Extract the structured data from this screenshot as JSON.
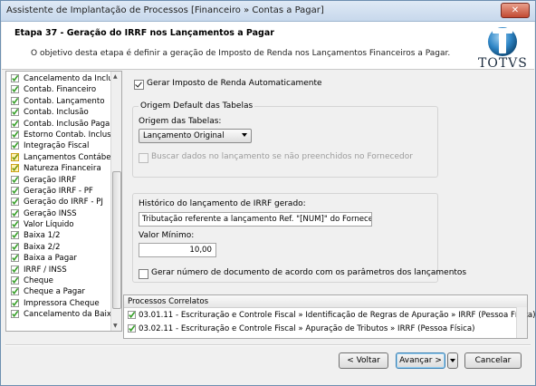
{
  "window": {
    "title": "Assistente de Implantação de Processos [Financeiro » Contas a Pagar]",
    "close_glyph": "✕"
  },
  "header": {
    "title": "Etapa 37 - Geração do IRRF nos Lançamentos a Pagar",
    "description": "O objetivo desta etapa é definir a geração de Imposto de Renda nos Lançamentos Financeiros a Pagar.",
    "logo_text": "TOTVS"
  },
  "steps": [
    {
      "label": "Cancelamento da Inclusão",
      "icon": "check-icon"
    },
    {
      "label": "Contab. Financeiro",
      "icon": "check-icon"
    },
    {
      "label": "Contab. Lançamento",
      "icon": "check-icon"
    },
    {
      "label": "Contab. Inclusão",
      "icon": "check-icon"
    },
    {
      "label": "Contab. Inclusão Pagar",
      "icon": "check-icon"
    },
    {
      "label": "Estorno Contab. Inclusão",
      "icon": "check-icon"
    },
    {
      "label": "Integração Fiscal",
      "icon": "check-icon"
    },
    {
      "label": "Lançamentos Contábeis",
      "icon": "warning-check-icon"
    },
    {
      "label": "Natureza Financeira",
      "icon": "warning-check-icon"
    },
    {
      "label": "Geração IRRF",
      "icon": "check-icon"
    },
    {
      "label": "Geração IRRF - PF",
      "icon": "check-icon"
    },
    {
      "label": "Geração do IRRF - PJ",
      "icon": "check-icon"
    },
    {
      "label": "Geração INSS",
      "icon": "check-icon"
    },
    {
      "label": "Valor Líquido",
      "icon": "check-icon"
    },
    {
      "label": "Baixa 1/2",
      "icon": "check-icon"
    },
    {
      "label": "Baixa 2/2",
      "icon": "check-icon"
    },
    {
      "label": "Baixa a Pagar",
      "icon": "check-icon"
    },
    {
      "label": "IRRF / INSS",
      "icon": "check-icon"
    },
    {
      "label": "Cheque",
      "icon": "check-icon"
    },
    {
      "label": "Cheque a Pagar",
      "icon": "check-icon"
    },
    {
      "label": "Impressora Cheque",
      "icon": "check-icon"
    },
    {
      "label": "Cancelamento da Baixa",
      "icon": "check-icon"
    }
  ],
  "form": {
    "gerar_irrf_label": "Gerar Imposto de Renda Automaticamente",
    "gerar_irrf_checked": true,
    "origem_group_title": "Origem Default das Tabelas",
    "origem_label": "Origem das Tabelas:",
    "origem_value": "Lançamento Original",
    "buscar_label": "Buscar dados no lançamento se não preenchidos no Fornecedor",
    "buscar_checked": false,
    "historico_label": "Histórico do lançamento de IRRF gerado:",
    "historico_value": "Tributação referente a lançamento Ref. \"[NUM]\" do Fornecedor [NO",
    "valor_minimo_label": "Valor Mínimo:",
    "valor_minimo_value": "10,00",
    "gerar_numero_label": "Gerar número de documento de acordo com os parâmetros dos lançamentos",
    "gerar_numero_checked": false
  },
  "correlatos": {
    "title": "Processos Correlatos",
    "items": [
      "03.01.11 - Escrituração e Controle Fiscal » Identificação de Regras de Apuração » IRRF (Pessoa Física)",
      "03.02.11 - Escrituração e Controle Fiscal » Apuração de Tributos » IRRF (Pessoa Física)"
    ]
  },
  "buttons": {
    "voltar": "< Voltar",
    "avancar": "Avançar >",
    "cancelar": "Cancelar"
  },
  "colors": {
    "check_green": "#3aa02c",
    "warning_yellow": "#f0c419",
    "titlebar_blue": "#c7d8ec"
  }
}
